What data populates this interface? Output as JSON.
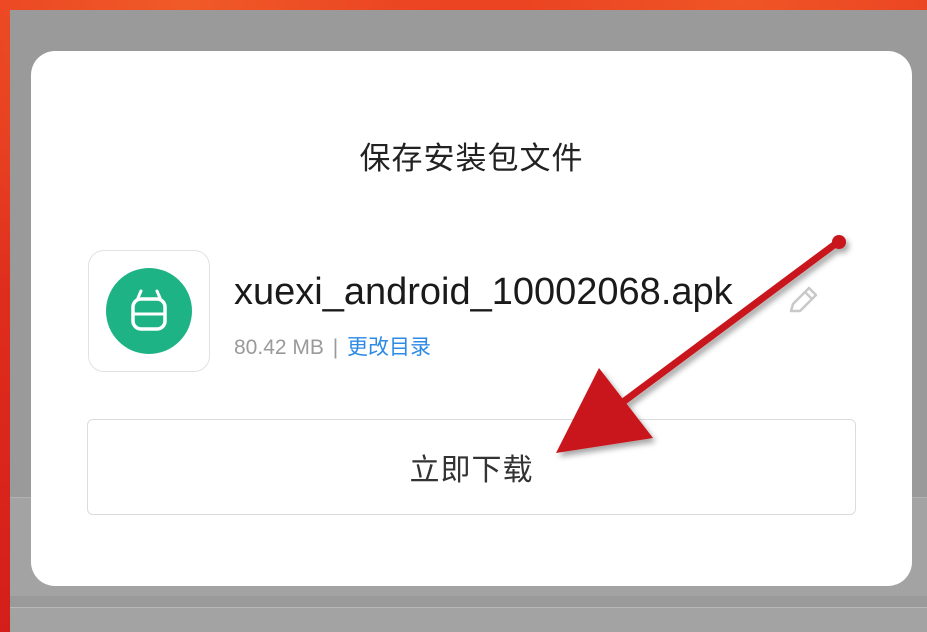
{
  "dialog": {
    "title": "保存安装包文件",
    "file": {
      "name": "xuexi_android_10002068.apk",
      "size": "80.42 MB",
      "separator": "|",
      "change_dir_label": "更改目录"
    },
    "download_button_label": "立即下载"
  },
  "icons": {
    "app_icon": "android-app-icon",
    "edit": "pencil-icon"
  },
  "colors": {
    "accent_link": "#2d8ae6",
    "app_icon_bg": "#1db385",
    "annotation_arrow": "#c8161d"
  }
}
